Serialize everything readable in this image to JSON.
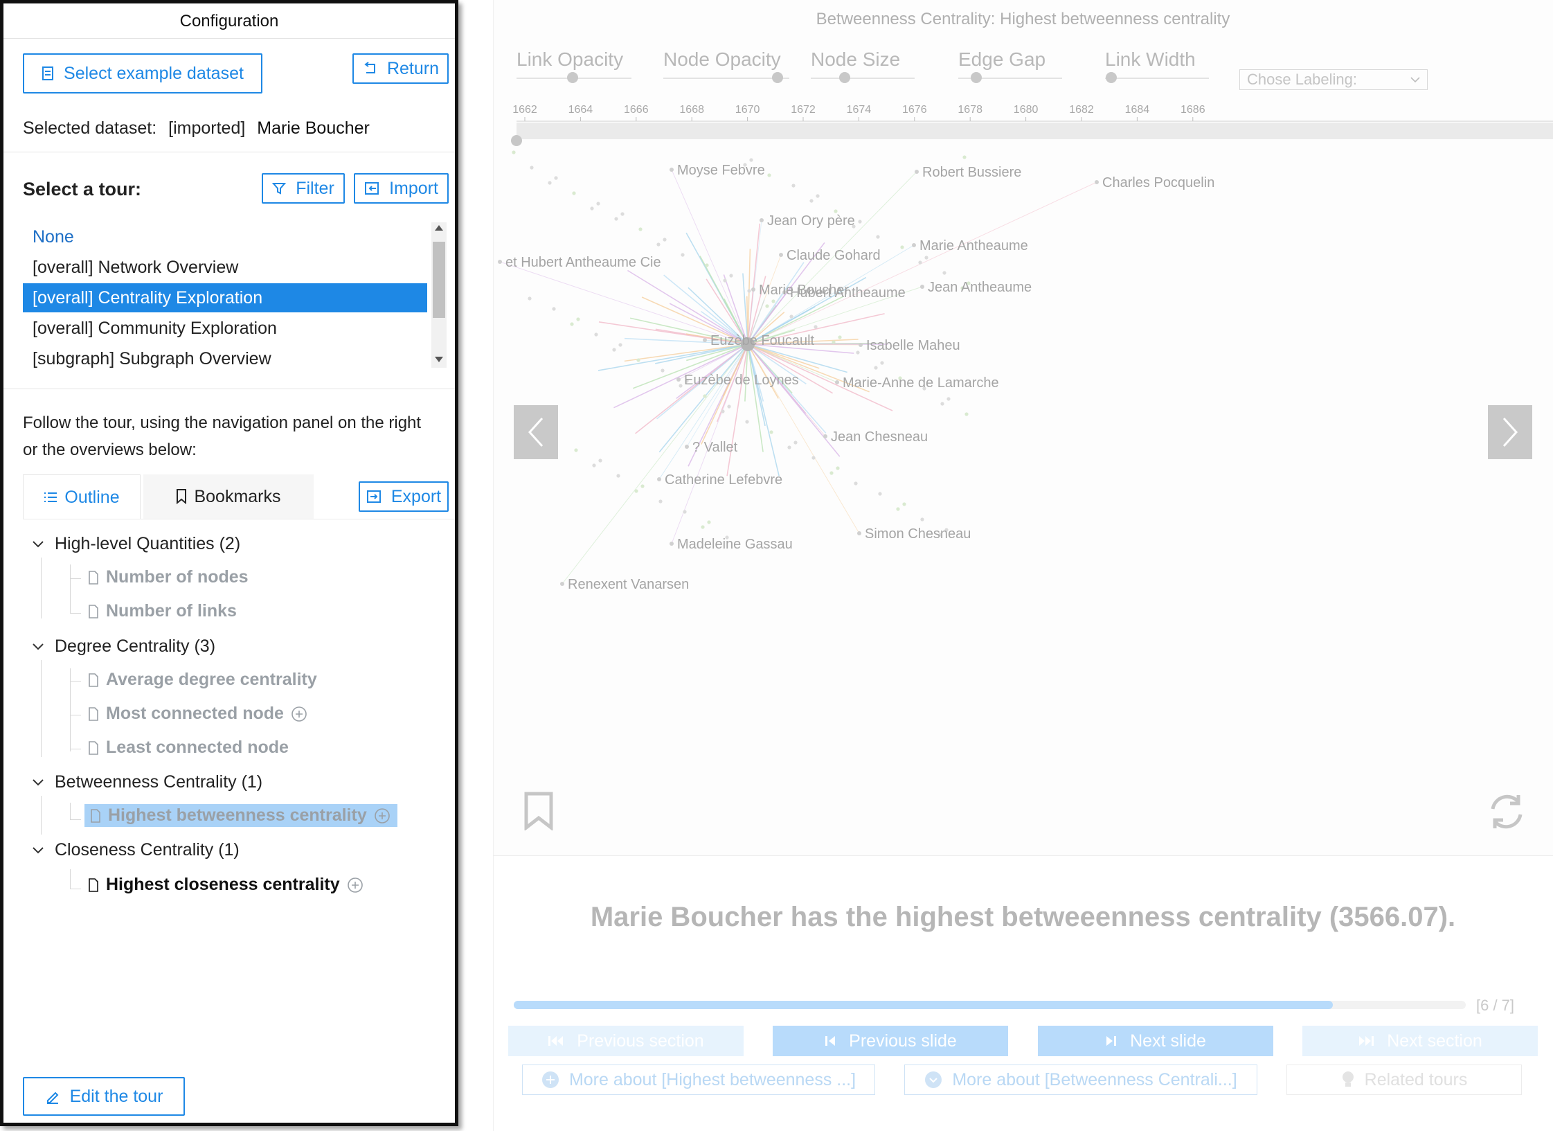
{
  "config": {
    "title": "Configuration",
    "select_dataset_label": "Select example dataset",
    "return_label": "Return",
    "selected_dataset_prefix": "Selected dataset:",
    "selected_dataset_source": "[imported]",
    "selected_dataset_name": "Marie Boucher",
    "select_tour_label": "Select a tour:",
    "filter_label": "Filter",
    "import_label": "Import",
    "tours": [
      {
        "label": "None"
      },
      {
        "label": "[overall]  Network Overview"
      },
      {
        "label": "[overall]  Centrality Exploration"
      },
      {
        "label": "[overall]  Community Exploration"
      },
      {
        "label": "[subgraph]  Subgraph Overview"
      }
    ],
    "instructions": [
      "Follow the tour, using the navigation panel on the right",
      "or the overviews below:"
    ],
    "tabs": {
      "outline": "Outline",
      "bookmarks": "Bookmarks"
    },
    "export_label": "Export",
    "outline": {
      "sections": [
        {
          "label": "High-level Quantities  (2)",
          "items": [
            "Number of nodes",
            "Number of links"
          ]
        },
        {
          "label": "Degree Centrality  (3)",
          "items": [
            "Average degree centrality",
            "Most connected node",
            "Least connected node"
          ]
        },
        {
          "label": "Betweenness Centrality  (1)",
          "items": [
            "Highest betweenness centrality"
          ]
        },
        {
          "label": "Closeness Centrality  (1)",
          "items": [
            "Highest closeness centrality"
          ]
        }
      ]
    },
    "edit_tour_label": "Edit the tour"
  },
  "viewer": {
    "title": "Betweenness Centrality: Highest betweenness centrality",
    "sliders": [
      "Link Opacity",
      "Node Opacity",
      "Node Size",
      "Edge Gap",
      "Link Width"
    ],
    "labeling_placeholder": "Chose Labeling:",
    "timeline_ticks": [
      "1662",
      "1664",
      "1666",
      "1668",
      "1670",
      "1672",
      "1674",
      "1676",
      "1678",
      "1680",
      "1682",
      "1684",
      "1686"
    ],
    "node_labels": [
      "Moyse Febvre",
      "Robert Bussiere",
      "Charles Pocquelin",
      "Jean Ory père",
      "Marie Antheaume",
      "Claude Gohard",
      "et Hubert Antheaume Cie",
      "Jean Antheaume",
      "Marie Boucher",
      "Hubert Antheaume",
      "Euzèbe Foucault",
      "Isabelle Maheu",
      "Euzèbe de Loynes",
      "Marie-Anne de Lamarche",
      "Jean Chesneau",
      "? Vallet",
      "Catherine Lefebvre",
      "Simon Chesneau",
      "Madeleine Gassau",
      "Renexent Vanarsen"
    ],
    "message": "Marie Boucher has the highest betweeenness centrality (3566.07).",
    "progress": {
      "value": 0.86,
      "label": "[6 / 7]"
    },
    "buttons": {
      "prev_section": "Previous section",
      "prev_slide": "Previous slide",
      "next_slide": "Next slide",
      "next_section": "Next section",
      "more_about_node": "More about [Highest betweenness ...]",
      "more_about_section": "More about [Betweenness Centrali...]",
      "related_tours": "Related tours"
    },
    "colors": {
      "accent": "#1e88e5",
      "selected_row": "#1e88e5",
      "highlight_leaf": "#a9d2f7",
      "progress_fill": "#b8dbfb"
    }
  }
}
